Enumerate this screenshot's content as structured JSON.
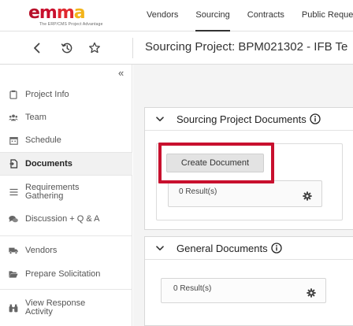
{
  "brand": {
    "logo_text": "emma",
    "tagline": "The ERP/CMS Project Advantage",
    "logo_colors": [
      "#b7102a",
      "#c8102e",
      "#e0282f",
      "#f3b41b"
    ]
  },
  "nav": {
    "items": [
      {
        "label": "Vendors",
        "active": false
      },
      {
        "label": "Sourcing",
        "active": true
      },
      {
        "label": "Contracts",
        "active": false
      },
      {
        "label": "Public Reque",
        "active": false
      }
    ]
  },
  "toolbar": {
    "back_icon": "chevron-left-icon",
    "history_icon": "history-icon",
    "favorite_icon": "star-outline-icon",
    "title": "Sourcing Project: BPM021302 - IFB Te"
  },
  "sidebar": {
    "collapse_glyph": "«",
    "items": [
      {
        "label": "Project Info",
        "icon": "clipboard-icon",
        "active": false
      },
      {
        "label": "Team",
        "icon": "users-icon",
        "active": false
      },
      {
        "label": "Schedule",
        "icon": "calendar-icon",
        "active": false
      },
      {
        "label": "Documents",
        "icon": "document-icon",
        "active": true
      },
      {
        "label": "Requirements Gathering",
        "icon": "list-icon",
        "active": false
      },
      {
        "label": "Discussion + Q & A",
        "icon": "comments-icon",
        "active": false
      },
      {
        "label": "Vendors",
        "icon": "truck-icon",
        "active": false
      },
      {
        "label": "Prepare Solicitation",
        "icon": "folder-open-icon",
        "active": false
      },
      {
        "label": "View Response Activity",
        "icon": "binoculars-icon",
        "active": false
      }
    ]
  },
  "sourcing_documents": {
    "title": "Sourcing Project Documents",
    "create_button": "Create Document",
    "results": "0 Result(s)"
  },
  "general_documents": {
    "title": "General Documents",
    "results": "0 Result(s)"
  },
  "colors": {
    "highlight": "#c8102e",
    "content_bg": "#f4f4f4",
    "button_bg": "#e3e3e3"
  }
}
